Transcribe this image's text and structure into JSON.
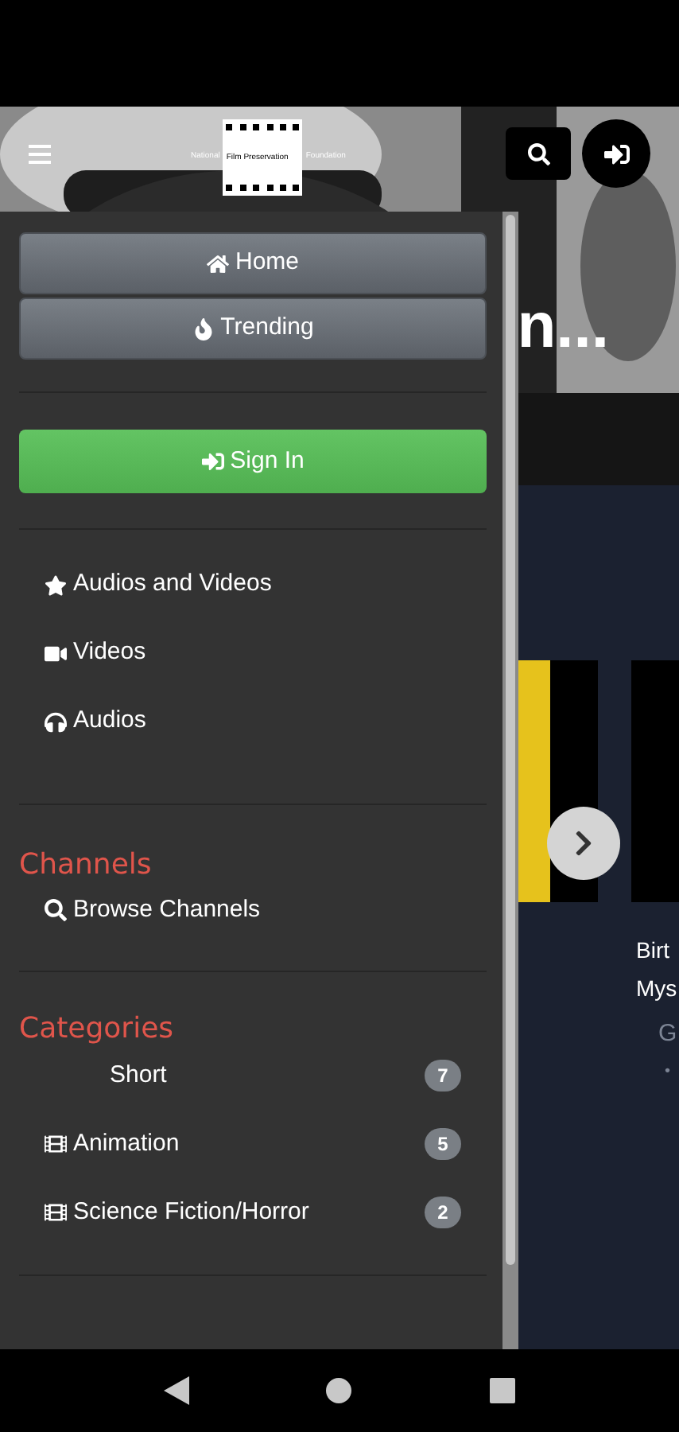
{
  "header": {
    "logo_text": [
      "National",
      "Film Preservation",
      "Foundation"
    ]
  },
  "hero": {
    "title_fragment": "n..."
  },
  "carousel": {
    "card_title_lines": [
      "Birt",
      "Mys"
    ],
    "card_meta": "G",
    "card_dot": "•"
  },
  "drawer": {
    "nav_buttons": [
      {
        "label": "Home",
        "kind": "home"
      },
      {
        "label": "Trending",
        "kind": "trending"
      }
    ],
    "sign_in": "Sign In",
    "media_links": [
      {
        "label": "Audios and Videos",
        "kind": "star"
      },
      {
        "label": "Videos",
        "kind": "video"
      },
      {
        "label": "Audios",
        "kind": "headphones"
      }
    ],
    "channels": {
      "heading": "Channels",
      "links": [
        {
          "label": "Browse Channels",
          "kind": "search"
        }
      ]
    },
    "categories": {
      "heading": "Categories",
      "items": [
        {
          "label": "Short",
          "count": "7",
          "kind": "plain"
        },
        {
          "label": "Animation",
          "count": "5",
          "kind": "film"
        },
        {
          "label": "Science Fiction/Horror",
          "count": "2",
          "kind": "film"
        }
      ]
    }
  }
}
